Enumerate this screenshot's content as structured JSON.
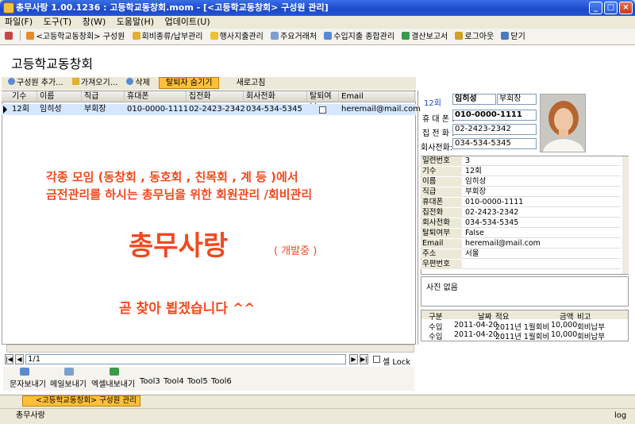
{
  "window": {
    "title": "총무사랑 1.00.1236 : 고등학교동창회.mom - [<고등학교동창회> 구성원 관리]"
  },
  "menu": [
    "파일(F)",
    "도구(T)",
    "창(W)",
    "도움말(H)",
    "업데이트(U)"
  ],
  "toolbar": [
    "<고등학교동창회> 구성원",
    "회비종류/납부관리",
    "행사지출관리",
    "주요거래처",
    "수입지출 종합관리",
    "결산보고서",
    "로그아웃",
    "닫기"
  ],
  "page_title": "고등학교동창회",
  "subbar": {
    "add": "구성원 추가...",
    "import": "가져오기...",
    "delete": "삭제",
    "hide": "탈퇴자 숨기기",
    "refresh": "새로고침"
  },
  "grid": {
    "headers": [
      "기수",
      "이름",
      "직급",
      "휴대폰",
      "집전화",
      "회사전화",
      "탈퇴여부",
      "Email"
    ],
    "row": [
      "12회",
      "임히성",
      "부회장",
      "010-0000-1111",
      "02-2423-2342",
      "034-534-5345",
      "",
      "heremail@mail.com"
    ]
  },
  "overlay": {
    "line1": "각종 모임 (동창회 , 동호회 , 친목회 , 계 등 )에서",
    "line2": "금전관리를 하시는 총무님을 위한  회원관리 /회비관리",
    "brand": "총무사랑",
    "brand_note": "( 개발중 )",
    "soon": "곧 찾아 뵙겠습니다 ^^"
  },
  "nav": {
    "position": "1/1",
    "cell_lock": "셀 Lock"
  },
  "bottom_tools": [
    "문자보내기",
    "메일보내기",
    "엑셀내보내기",
    "Tool3",
    "Tool4",
    "Tool5",
    "Tool6"
  ],
  "detail": {
    "grade": "12회",
    "name": "임히성",
    "position": "부회장",
    "mobile_label": "휴 대 폰 :",
    "mobile": "010-0000-1111",
    "home_label": "집 전 화 :",
    "home": "02-2423-2342",
    "office_label": "회사전화:",
    "office": "034-534-5345"
  },
  "properties": [
    {
      "k": "일련번호",
      "v": "3"
    },
    {
      "k": "기수",
      "v": "12회"
    },
    {
      "k": "이름",
      "v": "임히성"
    },
    {
      "k": "직급",
      "v": "부회장"
    },
    {
      "k": "휴대폰",
      "v": "010-0000-1111"
    },
    {
      "k": "집전화",
      "v": "02-2423-2342"
    },
    {
      "k": "회사전화",
      "v": "034-534-5345"
    },
    {
      "k": "탈퇴여부",
      "v": "False"
    },
    {
      "k": "Email",
      "v": "heremail@mail.com"
    },
    {
      "k": "주소",
      "v": "서울"
    },
    {
      "k": "우편번호",
      "v": ""
    }
  ],
  "memo": "사진 없음",
  "payments": {
    "headers": [
      "구분",
      "날짜",
      "적요",
      "금액",
      "비고"
    ],
    "rows": [
      [
        "수입",
        "2011-04-20",
        "2011년 1월회비",
        "10,000",
        "회비납부"
      ],
      [
        "수입",
        "2011-04-20",
        "2011년 1월회비",
        "10,000",
        "회비납부"
      ]
    ]
  },
  "taskbar": {
    "item": "<고등학교동창회> 구성원 관리"
  },
  "status": {
    "left": "총무사랑",
    "right": "log"
  }
}
